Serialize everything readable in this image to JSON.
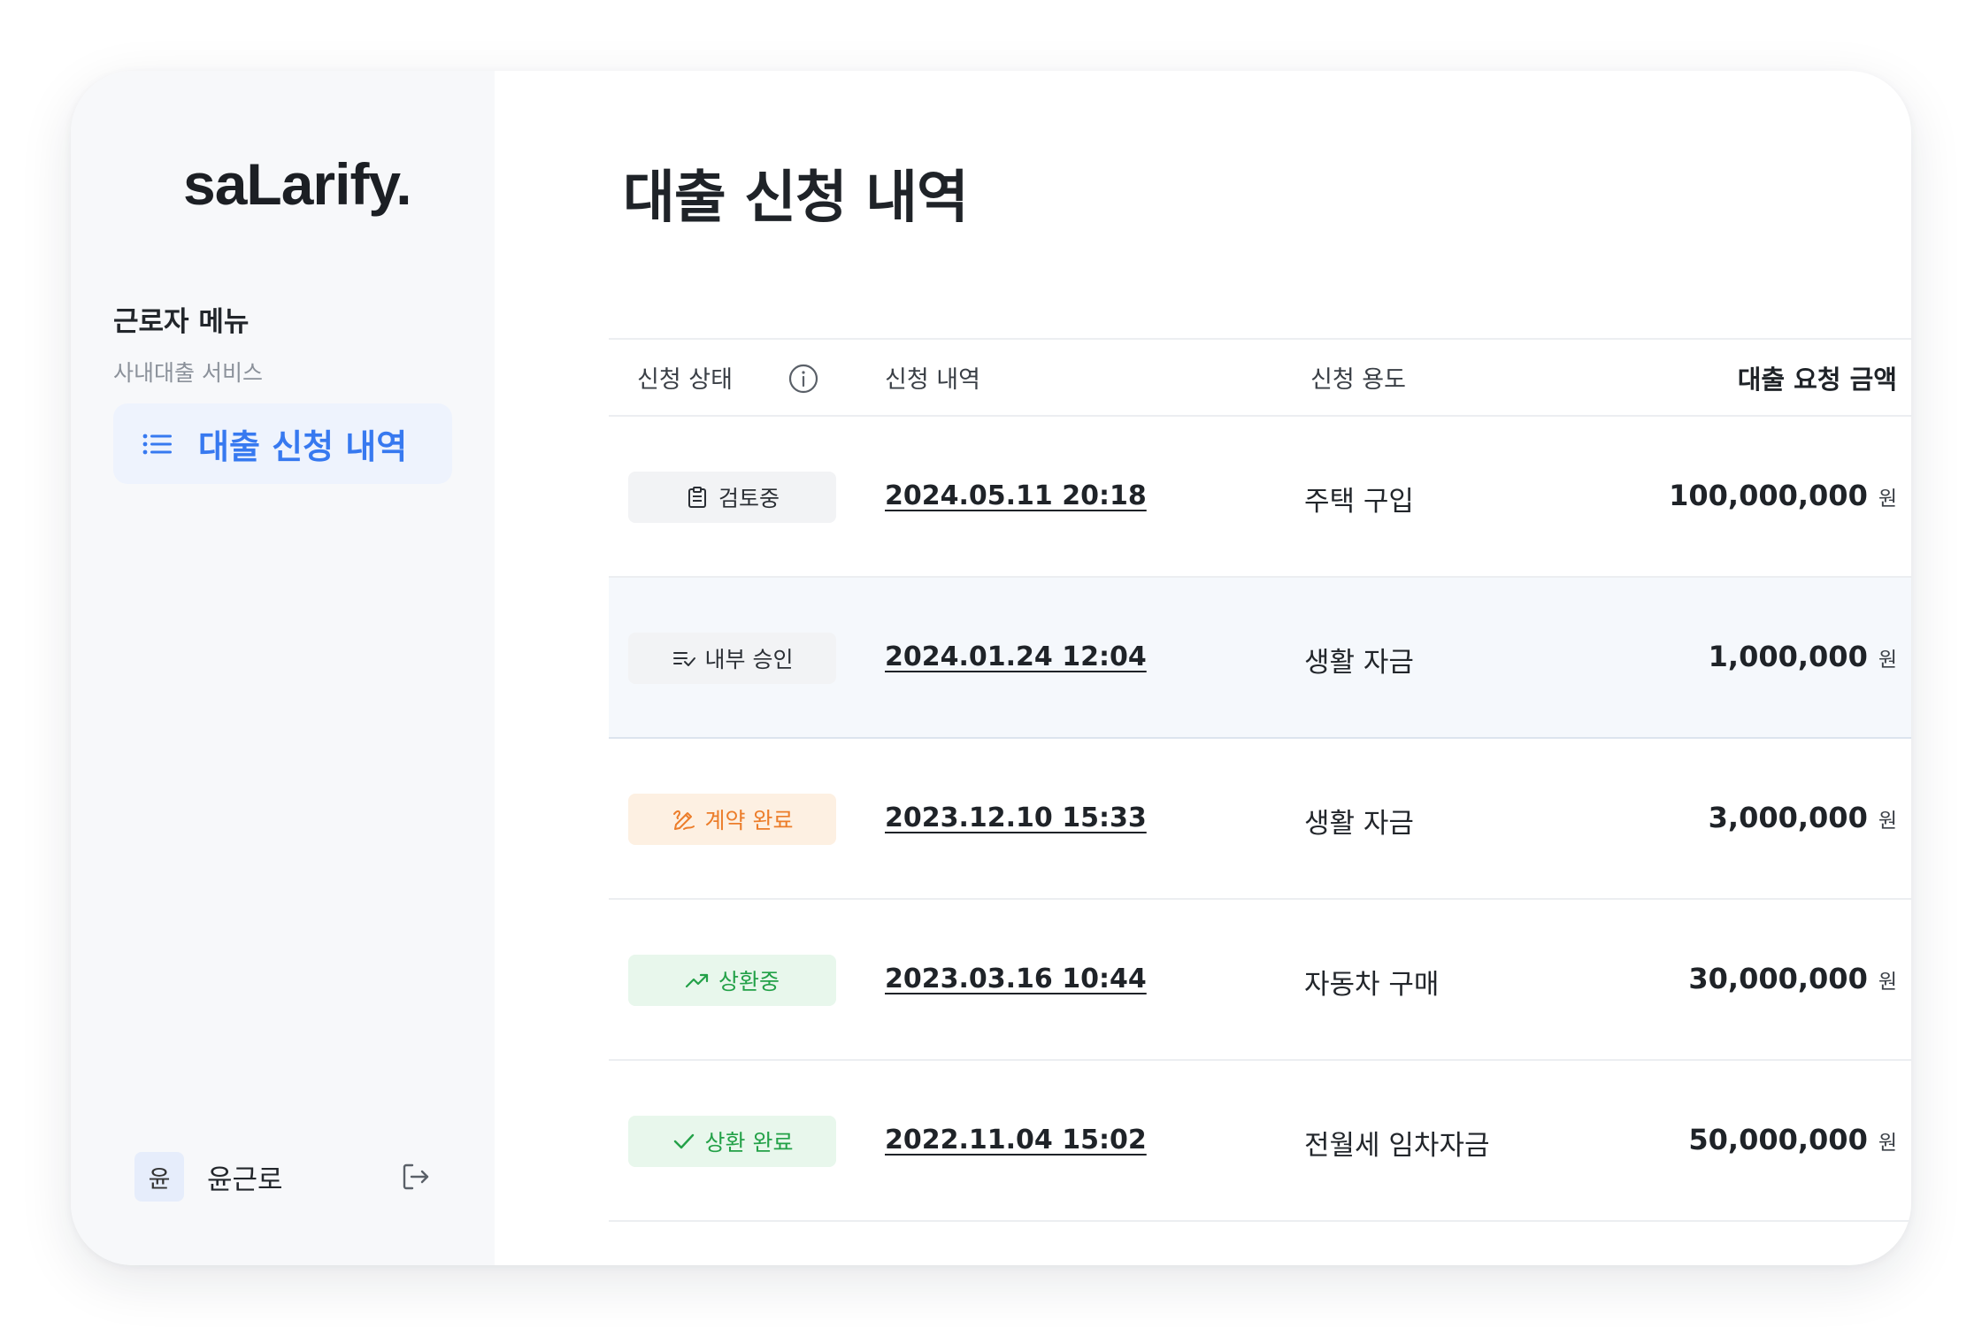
{
  "app": {
    "logo": "saLarify."
  },
  "sidebar": {
    "menu_title": "근로자 메뉴",
    "menu_subtitle": "사내대출 서비스",
    "nav_item": {
      "label": "대출 신청 내역",
      "icon": "list-icon",
      "active_color": "#3779f0"
    },
    "user": {
      "avatar_initial": "윤",
      "name": "윤근로",
      "logout_icon": "logout-icon"
    }
  },
  "main": {
    "title": "대출 신청 내역",
    "table": {
      "headers": {
        "status": "신청 상태",
        "status_info_icon": "info-icon",
        "date": "신청 내역",
        "purpose": "신청 용도",
        "amount": "대출 요청 금액"
      },
      "rows": [
        {
          "status": "검토중",
          "status_icon": "clipboard-icon",
          "status_color": "#2b2f35",
          "date": "2024.05.11 20:18",
          "purpose": "주택 구입",
          "amount": "100,000,000",
          "unit": "원"
        },
        {
          "status": "내부 승인",
          "status_icon": "list-check-icon",
          "status_color": "#2b2f35",
          "date": "2024.01.24 12:04",
          "purpose": "생활 자금",
          "amount": "1,000,000",
          "unit": "원"
        },
        {
          "status": "계약 완료",
          "status_icon": "signature-icon",
          "status_color": "#ec7d2a",
          "date": "2023.12.10 15:33",
          "purpose": "생활 자금",
          "amount": "3,000,000",
          "unit": "원"
        },
        {
          "status": "상환중",
          "status_icon": "trending-up-icon",
          "status_color": "#23a148",
          "date": "2023.03.16 10:44",
          "purpose": "자동차 구매",
          "amount": "30,000,000",
          "unit": "원"
        },
        {
          "status": "상환 완료",
          "status_icon": "check-icon",
          "status_color": "#23a148",
          "date": "2022.11.04 15:02",
          "purpose": "전월세 임차자금",
          "amount": "50,000,000",
          "unit": "원"
        }
      ]
    }
  }
}
